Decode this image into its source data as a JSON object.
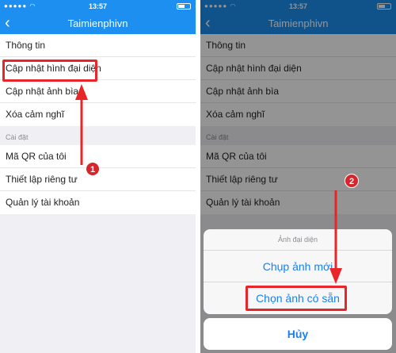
{
  "left_screen": {
    "status_time": "13:57",
    "nav_title": "Taimienphivn",
    "back_glyph": "‹",
    "group1": [
      "Thông tin",
      "Cập nhật hình đại diện",
      "Cập nhật ảnh bìa",
      "Xóa cảm nghĩ"
    ],
    "section_header": "Cài đặt",
    "group2": [
      "Mã QR của tôi",
      "Thiết lập riêng tư",
      "Quản lý tài khoản"
    ]
  },
  "right_screen": {
    "status_time": "13:57",
    "nav_title": "Taimienphivn",
    "back_glyph": "‹",
    "group1": [
      "Thông tin",
      "Cập nhật hình đại diện",
      "Cập nhật ảnh bìa",
      "Xóa cảm nghĩ"
    ],
    "section_header": "Cài đặt",
    "group2": [
      "Mã QR của tôi",
      "Thiết lập riêng tư",
      "Quản lý tài khoản"
    ],
    "action_sheet": {
      "title": "Ảnh đại diện",
      "take_photo": "Chụp ảnh mới",
      "choose_photo": "Chọn ảnh có sẵn",
      "cancel": "Hủy"
    }
  },
  "annotations": {
    "step1": "1",
    "step2": "2",
    "color": "#e8262a"
  },
  "colors": {
    "navbar": "#1d8ff0",
    "link": "#1a7ff0"
  }
}
